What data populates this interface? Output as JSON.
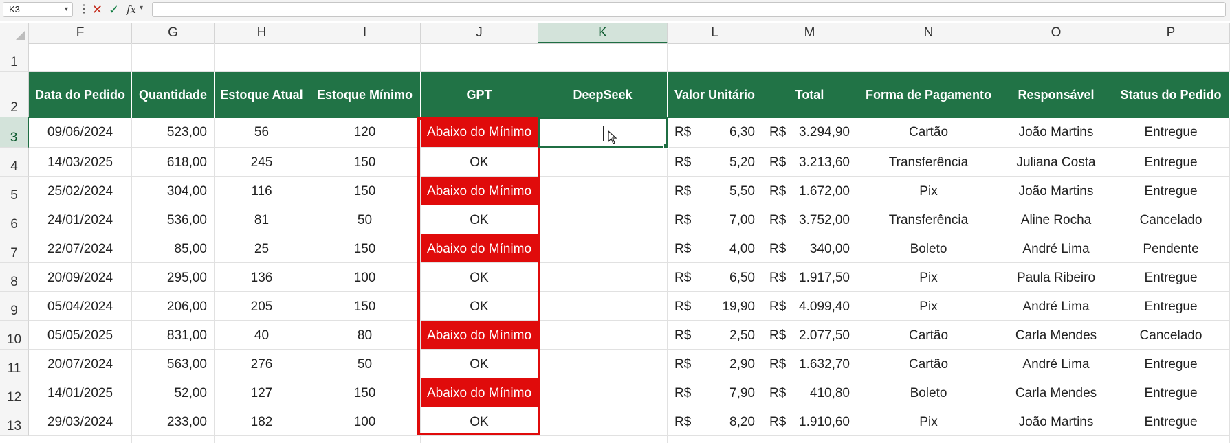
{
  "formula_bar": {
    "name_box": "K3",
    "formula": "",
    "fx_label": "fx"
  },
  "columns": [
    "F",
    "G",
    "H",
    "I",
    "J",
    "K",
    "L",
    "M",
    "N",
    "O",
    "P"
  ],
  "rows": [
    "1",
    "2",
    "3",
    "4",
    "5",
    "6",
    "7",
    "8",
    "9",
    "10",
    "11",
    "12",
    "13"
  ],
  "headers": [
    "Data do Pedido",
    "Quantidade",
    "Estoque Atual",
    "Estoque Mínimo",
    "GPT",
    "DeepSeek",
    "Valor Unitário",
    "Total",
    "Forma de Pagamento",
    "Responsável",
    "Status do Pedido"
  ],
  "currency": "R$",
  "data_rows": [
    {
      "data": "09/06/2024",
      "qtd": "523,00",
      "atual": "56",
      "minimo": "120",
      "gpt": "Abaixo do Mínimo",
      "deepseek": "",
      "valor": "6,30",
      "total": "3.294,90",
      "pagamento": "Cartão",
      "responsavel": "João Martins",
      "status": "Entregue"
    },
    {
      "data": "14/03/2025",
      "qtd": "618,00",
      "atual": "245",
      "minimo": "150",
      "gpt": "OK",
      "deepseek": "",
      "valor": "5,20",
      "total": "3.213,60",
      "pagamento": "Transferência",
      "responsavel": "Juliana Costa",
      "status": "Entregue"
    },
    {
      "data": "25/02/2024",
      "qtd": "304,00",
      "atual": "116",
      "minimo": "150",
      "gpt": "Abaixo do Mínimo",
      "deepseek": "",
      "valor": "5,50",
      "total": "1.672,00",
      "pagamento": "Pix",
      "responsavel": "João Martins",
      "status": "Entregue"
    },
    {
      "data": "24/01/2024",
      "qtd": "536,00",
      "atual": "81",
      "minimo": "50",
      "gpt": "OK",
      "deepseek": "",
      "valor": "7,00",
      "total": "3.752,00",
      "pagamento": "Transferência",
      "responsavel": "Aline Rocha",
      "status": "Cancelado"
    },
    {
      "data": "22/07/2024",
      "qtd": "85,00",
      "atual": "25",
      "minimo": "150",
      "gpt": "Abaixo do Mínimo",
      "deepseek": "",
      "valor": "4,00",
      "total": "340,00",
      "pagamento": "Boleto",
      "responsavel": "André Lima",
      "status": "Pendente"
    },
    {
      "data": "20/09/2024",
      "qtd": "295,00",
      "atual": "136",
      "minimo": "100",
      "gpt": "OK",
      "deepseek": "",
      "valor": "6,50",
      "total": "1.917,50",
      "pagamento": "Pix",
      "responsavel": "Paula Ribeiro",
      "status": "Entregue"
    },
    {
      "data": "05/04/2024",
      "qtd": "206,00",
      "atual": "205",
      "minimo": "150",
      "gpt": "OK",
      "deepseek": "",
      "valor": "19,90",
      "total": "4.099,40",
      "pagamento": "Pix",
      "responsavel": "André Lima",
      "status": "Entregue"
    },
    {
      "data": "05/05/2025",
      "qtd": "831,00",
      "atual": "40",
      "minimo": "80",
      "gpt": "Abaixo do Mínimo",
      "deepseek": "",
      "valor": "2,50",
      "total": "2.077,50",
      "pagamento": "Cartão",
      "responsavel": "Carla Mendes",
      "status": "Cancelado"
    },
    {
      "data": "20/07/2024",
      "qtd": "563,00",
      "atual": "276",
      "minimo": "50",
      "gpt": "OK",
      "deepseek": "",
      "valor": "2,90",
      "total": "1.632,70",
      "pagamento": "Cartão",
      "responsavel": "André Lima",
      "status": "Entregue"
    },
    {
      "data": "14/01/2025",
      "qtd": "52,00",
      "atual": "127",
      "minimo": "150",
      "gpt": "Abaixo do Mínimo",
      "deepseek": "",
      "valor": "7,90",
      "total": "410,80",
      "pagamento": "Boleto",
      "responsavel": "Carla Mendes",
      "status": "Entregue"
    },
    {
      "data": "29/03/2024",
      "qtd": "233,00",
      "atual": "182",
      "minimo": "100",
      "gpt": "OK",
      "deepseek": "",
      "valor": "8,20",
      "total": "1.910,60",
      "pagamento": "Pix",
      "responsavel": "João Martins",
      "status": "Entregue"
    }
  ],
  "colors": {
    "header_green": "#217346",
    "alert_red": "#e00b0b",
    "selection_green": "#1f6e43"
  },
  "icons": {
    "cancel": "cancel-x-icon",
    "enter": "checkmark-icon",
    "function": "fx-icon"
  }
}
